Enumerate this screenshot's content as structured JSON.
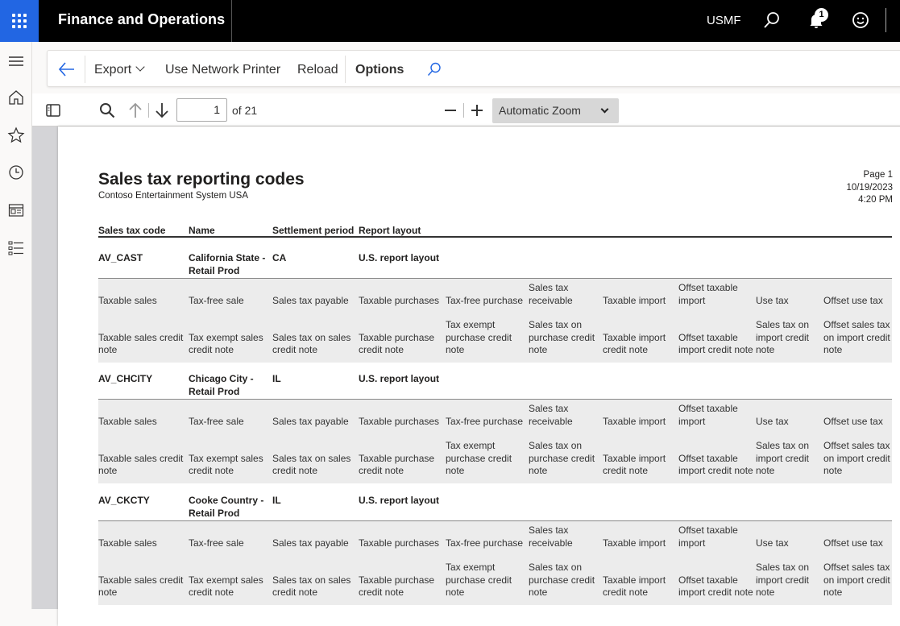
{
  "topbar": {
    "app_title": "Finance and Operations",
    "company": "USMF",
    "notification_count": "1",
    "icons": [
      "app-launcher-icon",
      "search-icon",
      "bell-icon",
      "smiley-icon"
    ]
  },
  "leftnav": {
    "icons": [
      "hamburger-icon",
      "home-icon",
      "star-icon",
      "clock-icon",
      "workspace-icon",
      "list-icon"
    ]
  },
  "actionpane": {
    "export_label": "Export",
    "network_printer_label": "Use Network Printer",
    "reload_label": "Reload",
    "options_label": "Options"
  },
  "pdf_toolbar": {
    "page_number": "1",
    "page_count_text": "of 21",
    "zoom_value": "Automatic Zoom"
  },
  "report": {
    "title": "Sales tax reporting codes",
    "subtitle": "Contoso Entertainment System USA",
    "page_label": "Page 1",
    "date": "10/19/2023",
    "time": "4:20 PM",
    "columns": [
      "Sales tax code",
      "Name",
      "Settlement period",
      "Report layout"
    ],
    "records": [
      {
        "code": "AV_CAST",
        "name_line1": "California State -",
        "name_line2": "Retail Prod",
        "period": "CA",
        "layout": "U.S. report layout"
      },
      {
        "code": "AV_CHCITY",
        "name_line1": "Chicago City -",
        "name_line2": "Retail Prod",
        "period": "IL",
        "layout": "U.S. report layout"
      },
      {
        "code": "AV_CKCTY",
        "name_line1": "Cooke Country -",
        "name_line2": "Retail Prod",
        "period": "IL",
        "layout": "U.S. report layout"
      }
    ],
    "row1": [
      [
        "",
        "Taxable sales"
      ],
      [
        "",
        "Tax-free sale"
      ],
      [
        "",
        "Sales tax payable"
      ],
      [
        "",
        "Taxable purchases"
      ],
      [
        "",
        "Tax-free purchase"
      ],
      [
        "Sales tax",
        "receivable"
      ],
      [
        "",
        "Taxable import"
      ],
      [
        "Offset taxable",
        "import"
      ],
      [
        "",
        "Use tax"
      ],
      [
        "",
        "Offset use tax"
      ]
    ],
    "row2": [
      [
        "",
        "Taxable sales credit",
        "note"
      ],
      [
        "",
        "Tax exempt sales",
        "credit note"
      ],
      [
        "",
        "Sales tax on sales",
        "credit note"
      ],
      [
        "",
        "Taxable purchase",
        "credit note"
      ],
      [
        "Tax exempt",
        "purchase credit",
        "note"
      ],
      [
        "Sales tax on",
        "purchase credit",
        "note"
      ],
      [
        "",
        "Taxable import",
        "credit note"
      ],
      [
        "",
        "Offset taxable",
        "import credit note"
      ],
      [
        "Sales tax on",
        "import credit",
        "note"
      ],
      [
        "Offset sales tax",
        "on import credit",
        "note"
      ]
    ]
  }
}
